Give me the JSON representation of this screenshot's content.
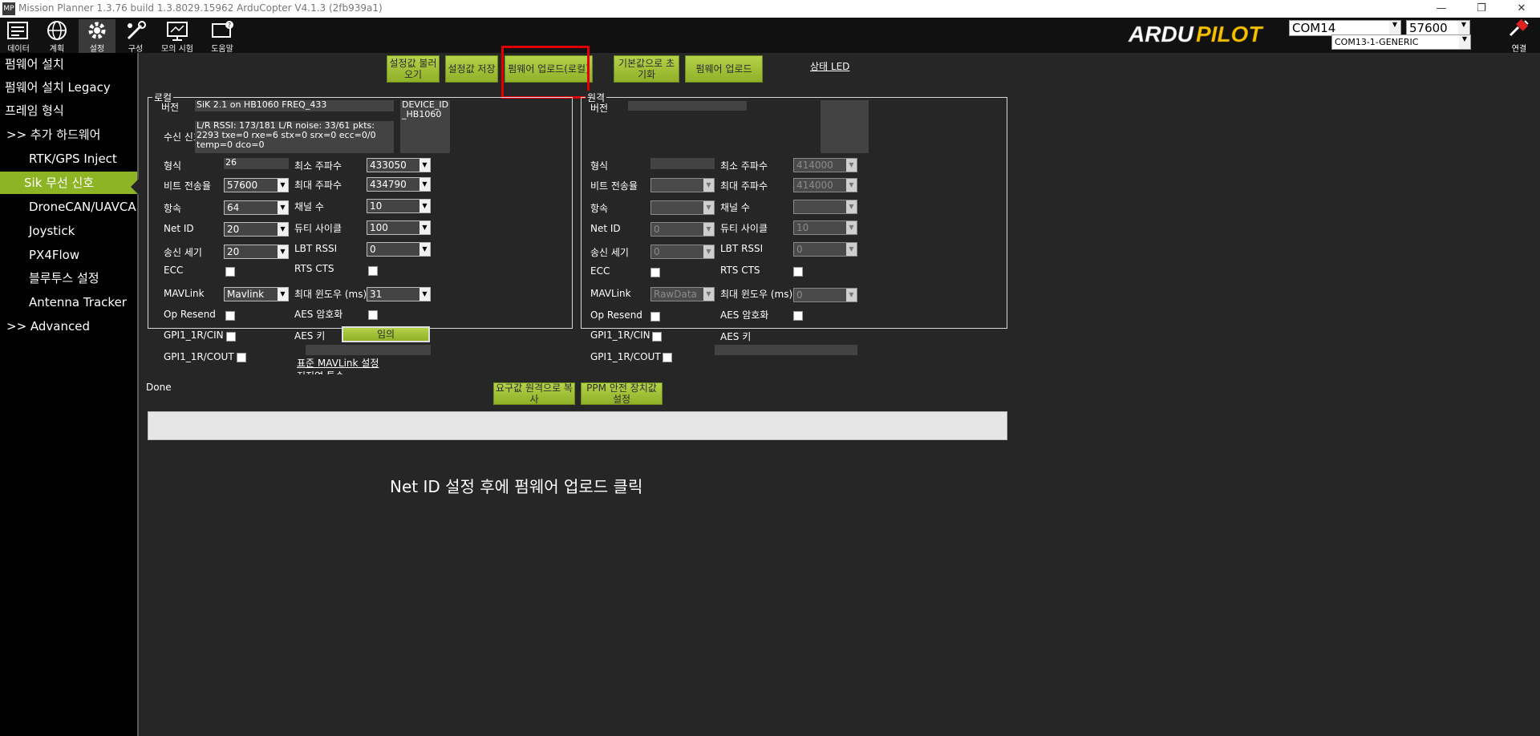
{
  "window": {
    "title": "Mission Planner 1.3.76 build 1.3.8029.15962 ArduCopter V4.1.3 (2fb939a1)",
    "icon_text": "MP"
  },
  "toolbar": {
    "items": [
      {
        "label": "데이터",
        "icon": "data-icon"
      },
      {
        "label": "계획",
        "icon": "globe-icon"
      },
      {
        "label": "설정",
        "icon": "setup-gear-icon"
      },
      {
        "label": "구성",
        "icon": "config-wrench-icon"
      },
      {
        "label": "모의 시험",
        "icon": "simulation-icon"
      },
      {
        "label": "도움말",
        "icon": "help-icon"
      }
    ],
    "logo": {
      "part1": "ARDU",
      "part2": "PILOT"
    },
    "port": "COM14",
    "baud": "57600",
    "port_desc": "COM13-1-GENERIC",
    "connect_label": "연결"
  },
  "sidebar": {
    "items": [
      {
        "label": "펌웨어 설치"
      },
      {
        "label": "펌웨어 설치 Legacy"
      },
      {
        "label": "프레임 형식"
      },
      {
        "label": ">> 추가 하드웨어"
      },
      {
        "label": "RTK/GPS Inject"
      },
      {
        "label": "Sik 무선 신호"
      },
      {
        "label": "DroneCAN/UAVCAN"
      },
      {
        "label": "Joystick"
      },
      {
        "label": "PX4Flow"
      },
      {
        "label": "블루투스 설정"
      },
      {
        "label": "Antenna Tracker"
      },
      {
        "label": ">> Advanced"
      }
    ]
  },
  "top_buttons": {
    "load": "설정값 불러오기",
    "save": "설정값 저장",
    "upload_local": "펌웨어 업로드(로컬)",
    "reset_default": "기본값으로 초기화",
    "upload_fw": "펌웨어 업로드",
    "status_led": "상태 LED"
  },
  "local": {
    "title": "로컬",
    "version_label": "버전",
    "version_value": "SiK 2.1 on HB1060        FREQ_433",
    "device_id": "DEVICE_ID _HB1060",
    "rssi_label": "수신 신호",
    "rssi_value": "L/R RSSI: 173/181  L/R noise: 33/61 pkts: 2293  txe=0 rxe=6 stx=0 srx=0 ecc=0/0 temp=0 dco=0",
    "format_label": "형식",
    "format_value": "26",
    "baud_label": "비트 전송율",
    "baud_value": "57600",
    "airspeed_label": "항속",
    "airspeed_value": "64",
    "netid_label": "Net ID",
    "netid_value": "20",
    "txpower_label": "송신 세기",
    "txpower_value": "20",
    "ecc_label": "ECC",
    "mavlink_label": "MAVLink",
    "mavlink_value": "Mavlink",
    "opresend_label": "Op Resend",
    "gpi_cin_label": "GPI1_1R/CIN",
    "gpi_cout_label": "GPI1_1R/COUT",
    "minfreq_label": "최소 주파수",
    "minfreq_value": "433050",
    "maxfreq_label": "최대 주파수",
    "maxfreq_value": "434790",
    "channels_label": "채널 수",
    "channels_value": "10",
    "duty_label": "듀티 사이클",
    "duty_value": "100",
    "lbt_label": "LBT RSSI",
    "lbt_value": "0",
    "rtscts_label": "RTS CTS",
    "maxwin_label": "최대 윈도우 (ms)",
    "maxwin_value": "31",
    "aes_label": "AES 암호화",
    "aeskey_label": "AES 키",
    "random_label": "임의",
    "std_mavlink": "표준 MAVLink 설정",
    "low_latency": "저지연 특수"
  },
  "remote": {
    "title": "원격",
    "version_label": "버전",
    "format_label": "형식",
    "baud_label": "비트 전송율",
    "airspeed_label": "항속",
    "netid_label": "Net ID",
    "netid_value": "0",
    "txpower_label": "송신 세기",
    "txpower_value": "0",
    "ecc_label": "ECC",
    "mavlink_label": "MAVLink",
    "mavlink_value": "RawData",
    "opresend_label": "Op Resend",
    "gpi_cin_label": "GPI1_1R/CIN",
    "gpi_cout_label": "GPI1_1R/COUT",
    "minfreq_label": "최소 주파수",
    "minfreq_value": "414000",
    "maxfreq_label": "최대 주파수",
    "maxfreq_value": "414000",
    "channels_label": "채널 수",
    "duty_label": "듀티 사이클",
    "duty_value": "10",
    "lbt_label": "LBT RSSI",
    "lbt_value": "0",
    "rtscts_label": "RTS CTS",
    "maxwin_label": "최대 윈도우 (ms)",
    "maxwin_value": "0",
    "aes_label": "AES 암호화",
    "aeskey_label": "AES 키"
  },
  "bottom": {
    "status": "Done",
    "copy_required": "요구값 원격으로 복사",
    "ppm_failsafe": "PPM 안전 장치값 설정",
    "annotation": "Net ID 설정 후에 펌웨어 업로드 클릭"
  },
  "colors": {
    "accent": "#8cb424",
    "highlight_box": "#e00000",
    "background": "#262626"
  }
}
